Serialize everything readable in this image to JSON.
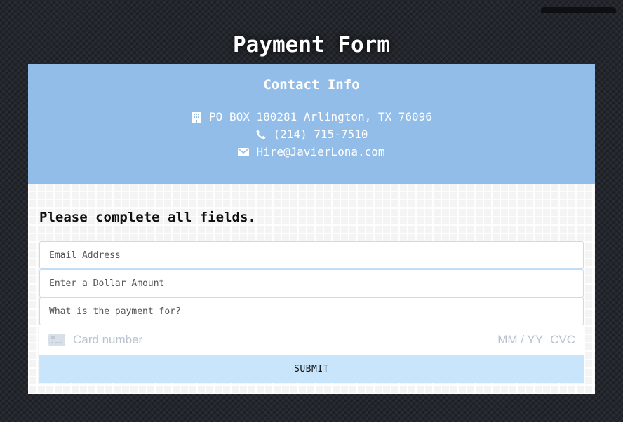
{
  "page": {
    "title": "Payment Form"
  },
  "contact": {
    "title": "Contact Info",
    "address": "PO BOX 180281 Arlington, TX 76096",
    "phone": "(214) 715-7510",
    "email": "Hire@JavierLona.com",
    "icons": [
      "building-icon",
      "phone-icon",
      "envelope-icon"
    ]
  },
  "form": {
    "instructions": "Please complete all fields.",
    "email_placeholder": "Email Address",
    "amount_placeholder": "Enter a Dollar Amount",
    "purpose_placeholder": "What is the payment for?",
    "card": {
      "icon": "credit-card-icon",
      "number_placeholder": "Card number",
      "expiry_placeholder": "MM / YY",
      "cvc_placeholder": "CVC"
    },
    "submit_label": "SUBMIT"
  },
  "colors": {
    "contact_bg": "#92bde8",
    "submit_bg": "#c8e5fb",
    "page_bg": "#23272d"
  }
}
